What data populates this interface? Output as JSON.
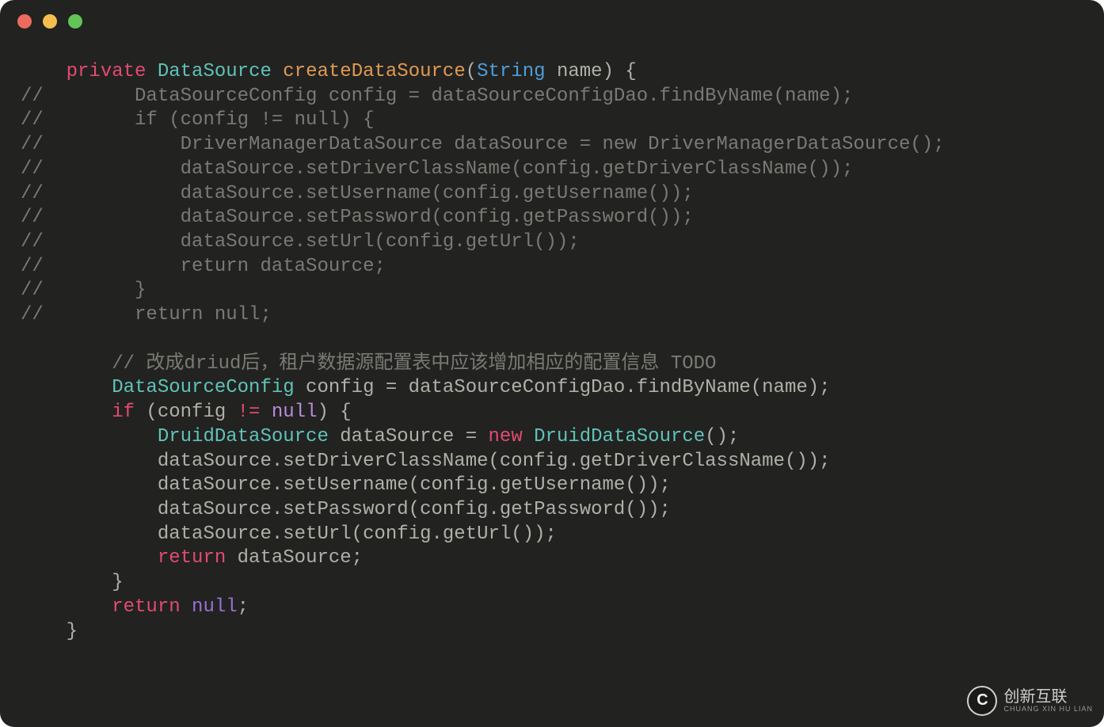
{
  "code": {
    "sig1_indent": "    ",
    "sig1_private": "private",
    "sig1_type": "DataSource",
    "sig1_method": "createDataSource",
    "sig1_open": "(",
    "sig1_ptype": "String",
    "sig1_pname": " name",
    "sig1_close": ") {",
    "c1": "//        DataSourceConfig config = dataSourceConfigDao.findByName(name);",
    "c2": "//        if (config != null) {",
    "c3": "//            DriverManagerDataSource dataSource = new DriverManagerDataSource();",
    "c4": "//            dataSource.setDriverClassName(config.getDriverClassName());",
    "c5": "//            dataSource.setUsername(config.getUsername());",
    "c6": "//            dataSource.setPassword(config.getPassword());",
    "c7": "//            dataSource.setUrl(config.getUrl());",
    "c8": "//            return dataSource;",
    "c9": "//        }",
    "c10": "//        return null;",
    "c_todo": "// 改成driud后，租户数据源配置表中应该增加相应的配置信息 TODO",
    "l_cfg_indent": "        ",
    "l_cfg_type": "DataSourceConfig",
    "l_cfg_rest": " config = dataSourceConfigDao.findByName(name);",
    "l_if_indent": "        ",
    "l_if_kw": "if",
    "l_if_open": " (config ",
    "l_if_op": "!=",
    "l_if_sp": " ",
    "l_if_null": "null",
    "l_if_close": ") {",
    "l_ds_indent": "            ",
    "l_ds_type1": "DruidDataSource",
    "l_ds_mid": " dataSource = ",
    "l_ds_new": "new",
    "l_ds_sp": " ",
    "l_ds_type2": "DruidDataSource",
    "l_ds_tail": "();",
    "l_set1": "            dataSource.setDriverClassName(config.getDriverClassName());",
    "l_set2": "            dataSource.setUsername(config.getUsername());",
    "l_set3": "            dataSource.setPassword(config.getPassword());",
    "l_set4": "            dataSource.setUrl(config.getUrl());",
    "l_ret_ds_indent": "            ",
    "l_ret_ds_kw": "return",
    "l_ret_ds_rest": " dataSource;",
    "l_brace_close": "        }",
    "l_ret_null_indent": "        ",
    "l_ret_null_kw": "return",
    "l_ret_null_sp": " ",
    "l_ret_null_val": "null",
    "l_ret_null_semi": ";",
    "l_method_close": "    }"
  },
  "watermark": {
    "logo_letter": "C",
    "name": "创新互联",
    "sub": "CHUANG XIN HU LIAN"
  }
}
